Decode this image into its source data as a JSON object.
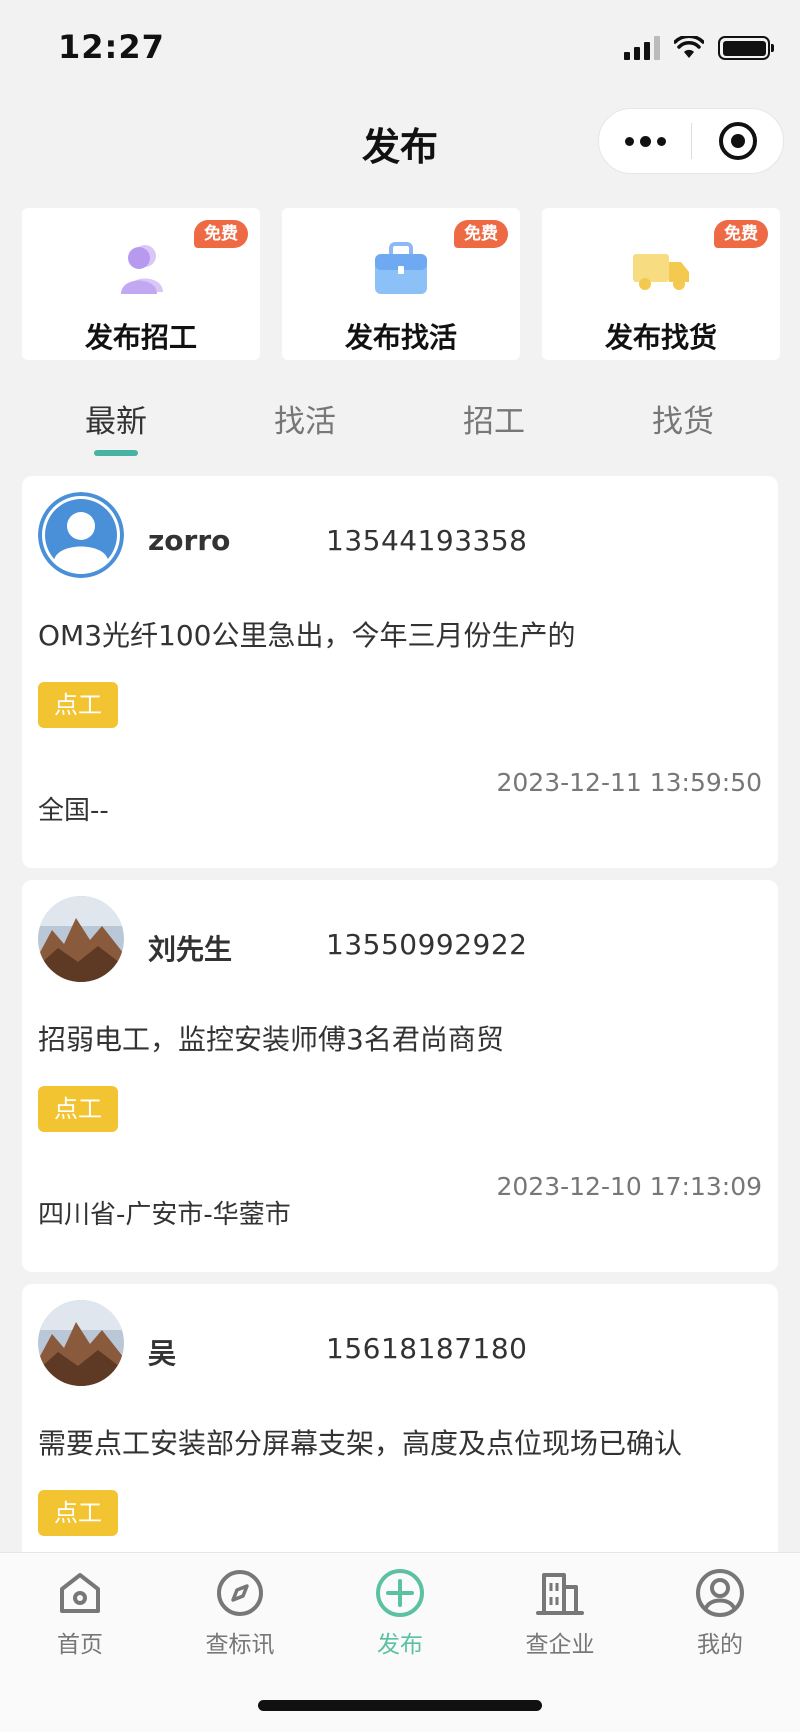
{
  "status_bar": {
    "time": "12:27"
  },
  "nav": {
    "title": "发布"
  },
  "publish_cards": [
    {
      "label": "发布招工",
      "badge": "免费",
      "icon": "people-icon"
    },
    {
      "label": "发布找活",
      "badge": "免费",
      "icon": "briefcase-icon"
    },
    {
      "label": "发布找货",
      "badge": "免费",
      "icon": "truck-icon"
    }
  ],
  "tabs": [
    {
      "label": "最新",
      "active": true
    },
    {
      "label": "找活",
      "active": false
    },
    {
      "label": "招工",
      "active": false
    },
    {
      "label": "找货",
      "active": false
    }
  ],
  "posts": [
    {
      "avatar": "default-user-avatar",
      "name": "zorro",
      "phone": "13544193358",
      "content": "OM3光纤100公里急出，今年三月份生产的",
      "tag": "点工",
      "time": "2023-12-11 13:59:50",
      "location": "全国--"
    },
    {
      "avatar": "landscape-photo-avatar",
      "name": "刘先生",
      "phone": "13550992922",
      "content": "招弱电工，监控安装师傅3名君尚商贸",
      "tag": "点工",
      "time": "2023-12-10 17:13:09",
      "location": "四川省-广安市-华蓥市"
    },
    {
      "avatar": "landscape-photo-avatar",
      "name": "吴",
      "phone": "15618187180",
      "content": "需要点工安装部分屏幕支架，高度及点位现场已确认",
      "tag": "点工",
      "time": "",
      "location": ""
    }
  ],
  "tabbar": [
    {
      "label": "首页",
      "icon": "home-icon",
      "active": false
    },
    {
      "label": "查标讯",
      "icon": "compass-icon",
      "active": false
    },
    {
      "label": "发布",
      "icon": "plus-circle-icon",
      "active": true
    },
    {
      "label": "查企业",
      "icon": "building-icon",
      "active": false
    },
    {
      "label": "我的",
      "icon": "user-circle-icon",
      "active": false
    }
  ],
  "colors": {
    "accent": "#48b3a3",
    "tab_active": "#5cc1a3",
    "tag": "#f3c431",
    "badge": "#ee6a45"
  }
}
